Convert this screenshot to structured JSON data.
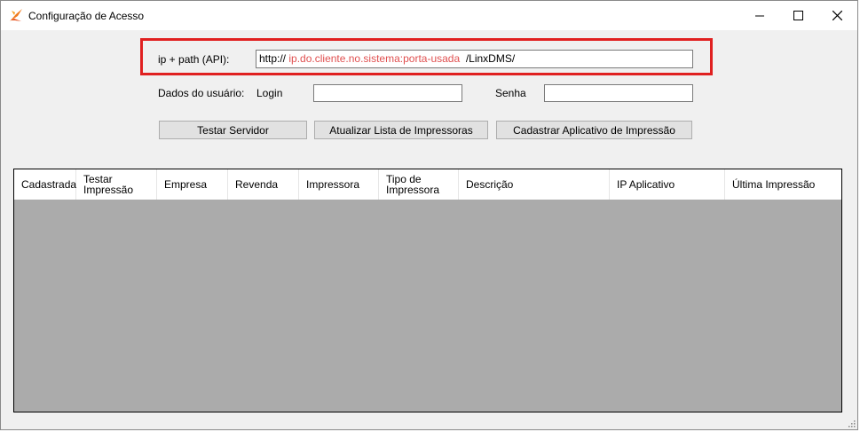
{
  "window": {
    "title": "Configuração de Acesso",
    "accent_color": "#e02020"
  },
  "api": {
    "label": "ip + path (API):",
    "url_prefix": "http://",
    "url_host": "ip.do.cliente.no.sistema:porta-usada",
    "url_path": "/LinxDMS/"
  },
  "user": {
    "label": "Dados do usuário:",
    "login_label": "Login",
    "login_value": "",
    "password_label": "Senha",
    "password_value": ""
  },
  "buttons": {
    "test_server": "Testar Servidor",
    "refresh_printers": "Atualizar Lista de Impressoras",
    "register_app": "Cadastrar Aplicativo de Impressão"
  },
  "grid": {
    "columns": [
      {
        "line1": "Cadastrada",
        "line2": ""
      },
      {
        "line1": "Testar",
        "line2": "Impressão"
      },
      {
        "line1": "Empresa",
        "line2": ""
      },
      {
        "line1": "Revenda",
        "line2": ""
      },
      {
        "line1": "Impressora",
        "line2": ""
      },
      {
        "line1": "Tipo de",
        "line2": "Impressora"
      },
      {
        "line1": "Descrição",
        "line2": ""
      },
      {
        "line1": "IP Aplicativo",
        "line2": ""
      },
      {
        "line1": "Última Impressão",
        "line2": ""
      }
    ],
    "rows": []
  }
}
